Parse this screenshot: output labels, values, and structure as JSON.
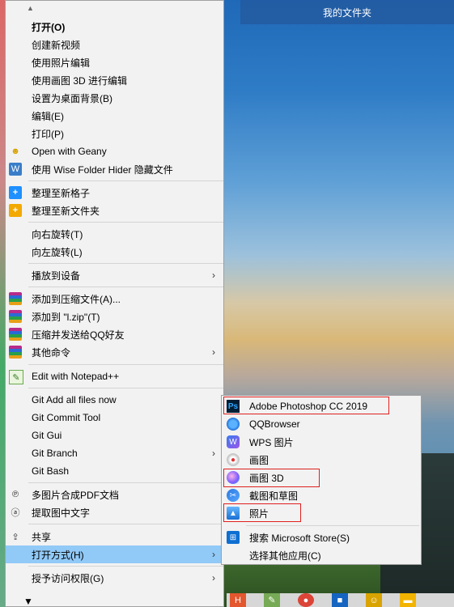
{
  "desktop": {
    "folder_label": "我的文件夹"
  },
  "context_menu": {
    "items": [
      {
        "label": "打开(O)"
      },
      {
        "label": "创建新视频"
      },
      {
        "label": "使用照片编辑"
      },
      {
        "label": "使用画图 3D 进行编辑"
      },
      {
        "label": "设置为桌面背景(B)"
      },
      {
        "label": "编辑(E)"
      },
      {
        "label": "打印(P)"
      },
      {
        "label": "Open with Geany"
      },
      {
        "label": "使用 Wise Folder Hider 隐藏文件"
      },
      {
        "label": "整理至新格子"
      },
      {
        "label": "整理至新文件夹"
      },
      {
        "label": "向右旋转(T)"
      },
      {
        "label": "向左旋转(L)"
      },
      {
        "label": "播放到设备"
      },
      {
        "label": "添加到压缩文件(A)..."
      },
      {
        "label": "添加到 \"l.zip\"(T)"
      },
      {
        "label": "压缩并发送给QQ好友"
      },
      {
        "label": "其他命令"
      },
      {
        "label": "Edit with Notepad++"
      },
      {
        "label": "Git Add all files now"
      },
      {
        "label": "Git Commit Tool"
      },
      {
        "label": "Git Gui"
      },
      {
        "label": "Git Branch"
      },
      {
        "label": "Git Bash"
      },
      {
        "label": "多图片合成PDF文档"
      },
      {
        "label": "提取图中文字"
      },
      {
        "label": "共享"
      },
      {
        "label": "打开方式(H)"
      },
      {
        "label": "授予访问权限(G)"
      }
    ],
    "arrow": "›"
  },
  "open_with_submenu": {
    "items": [
      {
        "label": "Adobe Photoshop CC 2019"
      },
      {
        "label": "QQBrowser"
      },
      {
        "label": "WPS 图片"
      },
      {
        "label": "画图"
      },
      {
        "label": "画图 3D"
      },
      {
        "label": "截图和草图"
      },
      {
        "label": "照片"
      },
      {
        "label": "搜索 Microsoft Store(S)"
      },
      {
        "label": "选择其他应用(C)"
      }
    ]
  },
  "colors": {
    "highlight": "#91c9f7",
    "annotation_box": "#e02020",
    "menu_bg": "#f2f2f2"
  }
}
